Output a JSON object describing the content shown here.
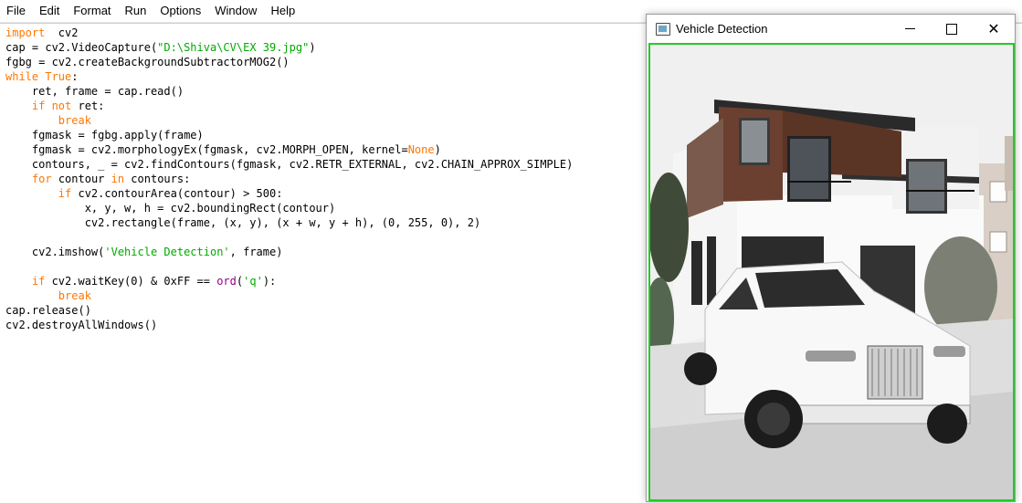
{
  "menu": [
    "File",
    "Edit",
    "Format",
    "Run",
    "Options",
    "Window",
    "Help"
  ],
  "code": [
    [
      [
        "kw",
        "import"
      ],
      [
        "",
        "  cv2"
      ]
    ],
    [
      [
        "",
        "cap = cv2.VideoCapture("
      ],
      [
        "str",
        "\"D:\\Shiva\\CV\\EX 39.jpg\""
      ],
      [
        "",
        ")"
      ]
    ],
    [
      [
        "",
        "fgbg = cv2.createBackgroundSubtractorMOG2()"
      ]
    ],
    [
      [
        "kw",
        "while"
      ],
      [
        "",
        ""
      ],
      [
        "kw",
        " True"
      ],
      [
        "",
        ":"
      ]
    ],
    [
      [
        "",
        "    ret, frame = cap.read()"
      ]
    ],
    [
      [
        "",
        "    "
      ],
      [
        "kw",
        "if not"
      ],
      [
        "",
        ""
      ],
      [
        "",
        ""
      ],
      [
        "",
        ""
      ],
      [
        "",
        " ret:"
      ]
    ],
    [
      [
        "",
        "        "
      ],
      [
        "kw",
        "break"
      ]
    ],
    [
      [
        "",
        "    fgmask = fgbg.apply(frame)"
      ]
    ],
    [
      [
        "",
        "    fgmask = cv2.morphologyEx(fgmask, cv2.MORPH_OPEN, kernel="
      ],
      [
        "kw",
        "None"
      ],
      [
        "",
        ")"
      ]
    ],
    [
      [
        "",
        "    contours, _ = cv2.findContours(fgmask, cv2.RETR_EXTERNAL, cv2.CHAIN_APPROX_SIMPLE)"
      ]
    ],
    [
      [
        "",
        "    "
      ],
      [
        "kw",
        "for"
      ],
      [
        "",
        " contour "
      ],
      [
        "kw",
        "in"
      ],
      [
        "",
        " contours:"
      ]
    ],
    [
      [
        "",
        "        "
      ],
      [
        "kw",
        "if"
      ],
      [
        "",
        " cv2.contourArea(contour) > 500:"
      ]
    ],
    [
      [
        "",
        "            x, y, w, h = cv2.boundingRect(contour)"
      ]
    ],
    [
      [
        "",
        "            cv2.rectangle(frame, (x, y), (x + w, y + h), (0, 255, 0), 2)"
      ]
    ],
    [
      [
        "",
        ""
      ]
    ],
    [
      [
        "",
        "    cv2.imshow("
      ],
      [
        "str",
        "'Vehicle Detection'"
      ],
      [
        "",
        ", frame)"
      ]
    ],
    [
      [
        "",
        ""
      ]
    ],
    [
      [
        "",
        "    "
      ],
      [
        "kw",
        "if"
      ],
      [
        "",
        " cv2.waitKey(0) & 0xFF == "
      ],
      [
        "builtin",
        "ord"
      ],
      [
        "",
        "("
      ],
      [
        "str",
        "'q'"
      ],
      [
        "",
        "):"
      ]
    ],
    [
      [
        "",
        "        "
      ],
      [
        "kw",
        "break"
      ]
    ],
    [
      [
        "",
        "cap.release()"
      ]
    ],
    [
      [
        "",
        "cv2.destroyAllWindows()"
      ]
    ]
  ],
  "image_window": {
    "title": "Vehicle Detection",
    "minimize_icon": "minimize-icon",
    "maximize_icon": "maximize-icon",
    "close_icon": "close-icon",
    "close_glyph": "✕",
    "border_color": "#22cc22"
  },
  "colors": {
    "keyword": "#ff7700",
    "string": "#00aa00",
    "builtin": "#900090"
  }
}
